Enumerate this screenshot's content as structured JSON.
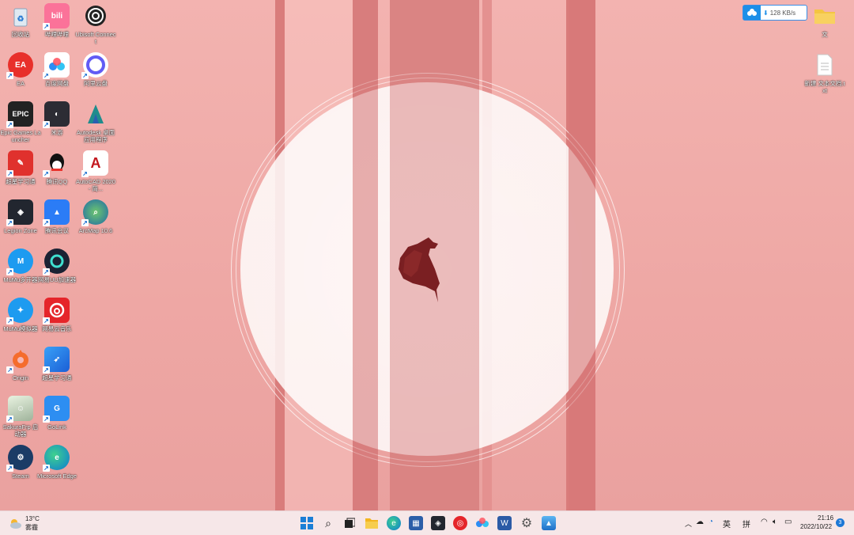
{
  "desktop": {
    "icons": [
      {
        "label": "回收站"
      },
      {
        "label": "哔哩哔哩"
      },
      {
        "label": "Ubisoft Connect"
      },
      {
        "label": "EA"
      },
      {
        "label": "百度网盘"
      },
      {
        "label": "阿里云盘"
      },
      {
        "label": "Epic Games Launcher"
      },
      {
        "label": "米游"
      },
      {
        "label": "Autodesk 桌面应用程序"
      },
      {
        "label": "超星学习通"
      },
      {
        "label": "腾讯QQ"
      },
      {
        "label": "AutoCAD 2020 - 简..."
      },
      {
        "label": "Legion Zone"
      },
      {
        "label": "腾讯会议"
      },
      {
        "label": "ArcMap 10.6"
      },
      {
        "label": "MuMu多开器"
      },
      {
        "label": "网易UU加速器"
      },
      {
        "label": "MuMu模拟器"
      },
      {
        "label": "网易云音乐"
      },
      {
        "label": "Origin"
      },
      {
        "label": "超星学习通"
      },
      {
        "label": "SakuraFrp 启动器"
      },
      {
        "label": "GoLink"
      },
      {
        "label": "Steam"
      },
      {
        "label": "Microsoft Edge"
      },
      {
        "label": "文"
      },
      {
        "label": "新建 文本文档.txt"
      }
    ],
    "speed_widget": {
      "text": "128 KB/s"
    }
  },
  "taskbar": {
    "weather": {
      "temp": "13°C",
      "condition": "雾霾"
    },
    "ime_lang": "英",
    "ime_mode": "拼",
    "time": "21:16",
    "date": "2022/10/22",
    "notification_count": "3"
  },
  "colors": {
    "wallpaper_bg": "#eea8a6",
    "stripe_dark": "#d9797a",
    "taskbar_bg": "#f6e7e8",
    "accent_blue": "#1d8fe8"
  }
}
